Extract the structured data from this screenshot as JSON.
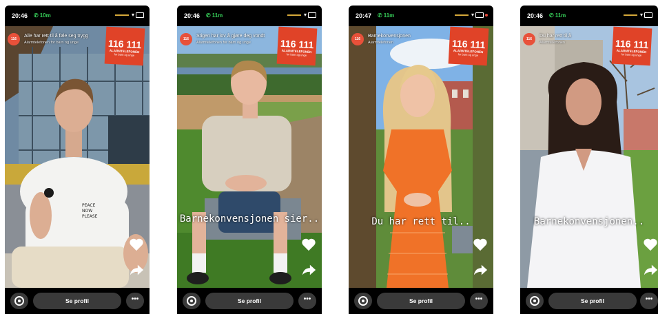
{
  "colors": {
    "badge": "#e04328",
    "call": "#37d15a",
    "pill": "#3a3a3a"
  },
  "phones": [
    {
      "time": "20:46",
      "call": "10m",
      "channel_title": "Alle har rett til å føle seg trygg",
      "channel_sub": "Alarmtelefonen for barn og unge",
      "badge_number": "116 111",
      "badge_label": "ALARMTELEFONEN",
      "badge_sub": "for barn og unge",
      "caption": "",
      "shirt_text": "PEACE PLEASE",
      "profile_label": "Se profil",
      "more_label": "•••"
    },
    {
      "time": "20:46",
      "call": "11m",
      "channel_title": "Stigen har lov å gjøre deg vondt",
      "channel_sub": "Alarmtelefonen for barn og unge",
      "badge_number": "116 111",
      "badge_label": "ALARMTELEFONEN",
      "badge_sub": "for barn og unge",
      "caption": "Barnekonvensjonen sier..",
      "profile_label": "Se profil",
      "more_label": "•••"
    },
    {
      "time": "20:47",
      "call": "11m",
      "channel_title": "Barnekonvensjonen",
      "channel_sub": "Alarmtelefonen",
      "badge_number": "116 111",
      "badge_label": "ALARMTELEFONEN",
      "badge_sub": "for barn og unge",
      "caption": "Du har rett til..",
      "profile_label": "Se profil",
      "more_label": "•••"
    },
    {
      "time": "20:46",
      "call": "11m",
      "channel_title": "Du har rett til å",
      "channel_sub": "Alarmtelefonen",
      "badge_number": "116 111",
      "badge_label": "ALARMTELEFONEN",
      "badge_sub": "for barn og unge",
      "caption": "Barnekonvensjonen..",
      "profile_label": "Se profil",
      "more_label": "•••"
    }
  ]
}
